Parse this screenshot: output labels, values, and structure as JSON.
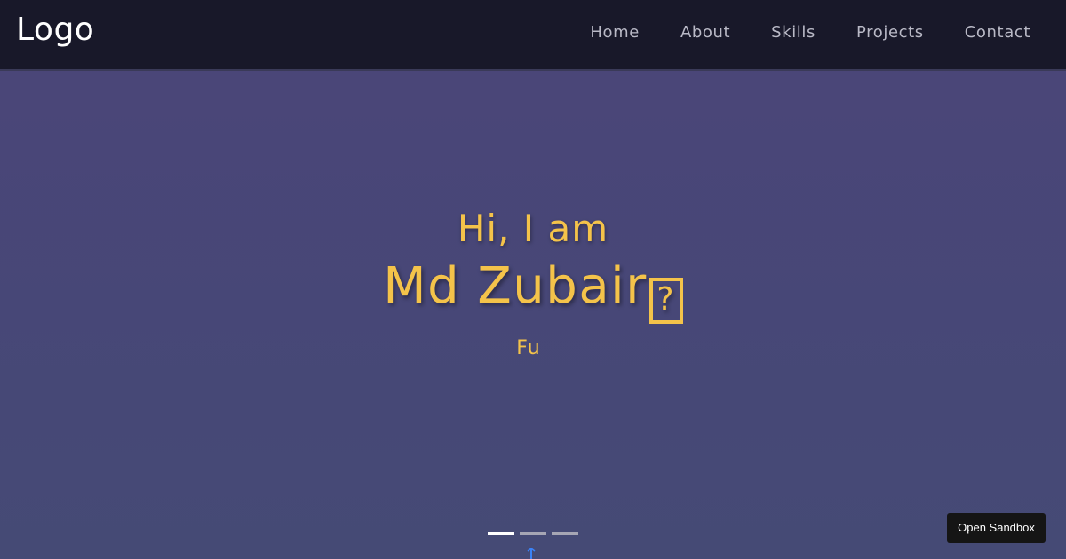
{
  "nav": {
    "logo": "Logo",
    "links": [
      "Home",
      "About",
      "Skills",
      "Projects",
      "Contact"
    ]
  },
  "hero": {
    "greeting": "Hi, I am",
    "name": "Md Zubair",
    "name_glyph": "?",
    "typed_text": "Fu",
    "carousel_active_index": 0,
    "carousel_count": 3
  },
  "sandbox": {
    "label": "Open Sandbox"
  },
  "colors": {
    "accent": "#f4c34a",
    "navbar_bg": "#181829",
    "hero_bg": "#4a4677",
    "nav_link": "#b9b9c6",
    "scroll_arrow": "#3b82f6"
  },
  "icons": {
    "scroll_down": "arrow-down-icon"
  }
}
